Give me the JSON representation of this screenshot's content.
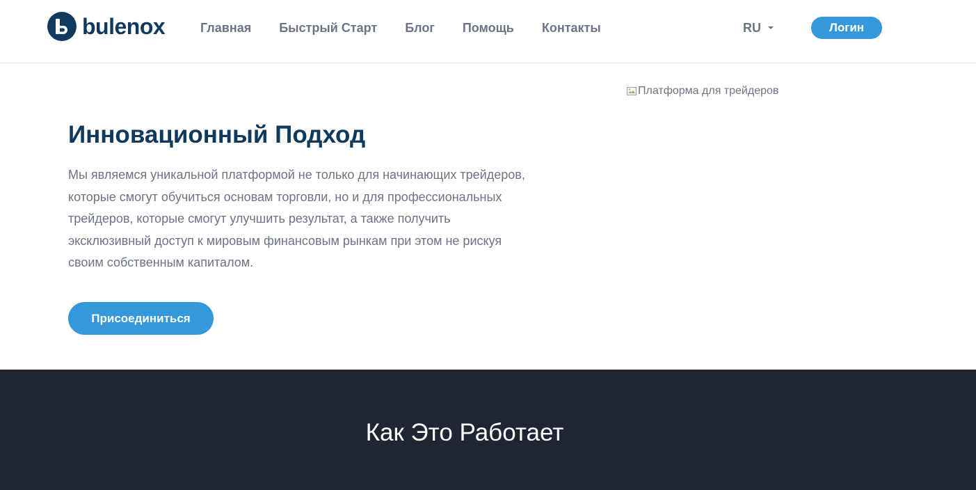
{
  "header": {
    "brand": "bulenox",
    "nav": [
      {
        "label": "Главная"
      },
      {
        "label": "Быстрый Старт"
      },
      {
        "label": "Блог"
      },
      {
        "label": "Помощь"
      },
      {
        "label": "Контакты"
      }
    ],
    "language": "RU",
    "login_label": "Логин"
  },
  "hero": {
    "title": "Инновационный Подход",
    "text": "Мы являемся уникальной платформой не только для начинающих трейдеров, которые смогут обучиться основам торговли, но и для профессиональных трейдеров, которые смогут улучшить результат, а также получить эксклюзивный доступ к мировым финансовым рынкам при этом не рискуя своим собственным капиталом.",
    "join_label": "Присоединиться",
    "image_alt": "Платформа для трейдеров"
  },
  "how_it_works": {
    "title": "Как Это Работает"
  },
  "colors": {
    "brand_dark": "#0f3a5e",
    "accent": "#3498db",
    "text_muted": "#6b7484",
    "dark_section": "#1f2533"
  }
}
